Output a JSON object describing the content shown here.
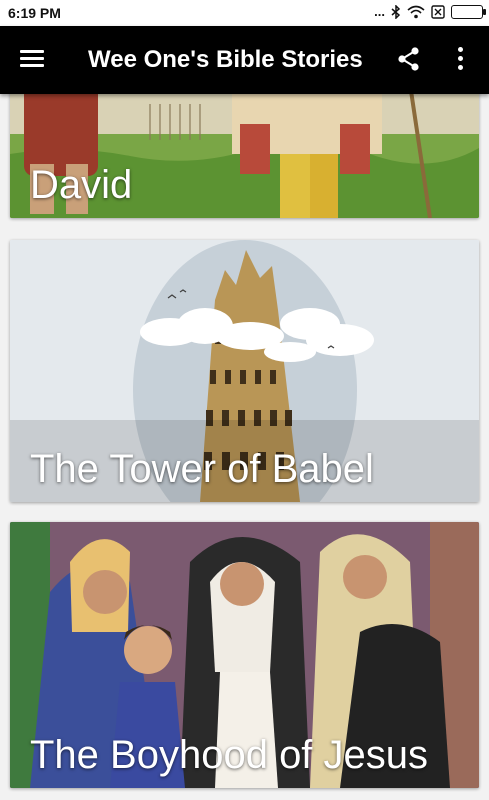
{
  "status_bar": {
    "time": "6:19 PM",
    "dots": "..."
  },
  "app_bar": {
    "title": "Wee One's Bible Stories"
  },
  "stories": [
    {
      "title": "David"
    },
    {
      "title": "The Tower of Babel"
    },
    {
      "title": "The Boyhood of Jesus"
    }
  ],
  "colors": {
    "app_bar_bg": "#000000",
    "caption_text": "#ffffff"
  }
}
